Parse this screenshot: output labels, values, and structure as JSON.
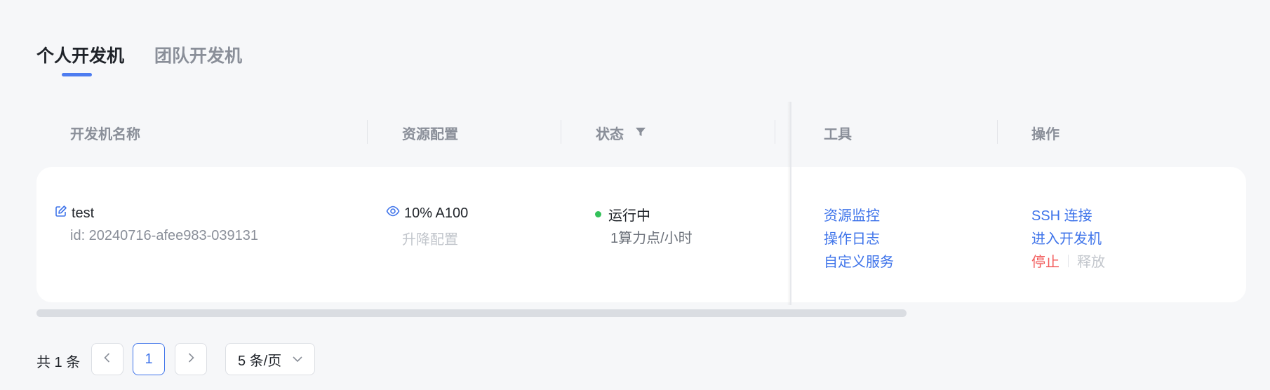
{
  "tabs": [
    {
      "label": "个人开发机",
      "active": true
    },
    {
      "label": "团队开发机",
      "active": false
    }
  ],
  "table": {
    "columns": [
      "开发机名称",
      "资源配置",
      "状态",
      "工具",
      "操作"
    ],
    "rows": [
      {
        "name": "test",
        "id": "id: 20240716-afee983-039131",
        "resource": "10% A100",
        "resource_action": "升降配置",
        "status": "运行中",
        "status_detail": "1算力点/小时",
        "tools": [
          "资源监控",
          "操作日志",
          "自定义服务"
        ],
        "actions": [
          "SSH 连接",
          "进入开发机",
          "停止",
          "释放"
        ]
      }
    ]
  },
  "pagination": {
    "total_label": "共 1 条",
    "current_page": "1",
    "page_size_label": "5 条/页"
  },
  "colors": {
    "accent": "#3f74ea",
    "running": "#34c15a",
    "danger": "#f25a5a",
    "muted": "#8a8f99"
  },
  "icons": {
    "edit": "edit-icon",
    "eye": "eye-icon",
    "filter": "filter-icon",
    "prev": "chevron-left-icon",
    "next": "chevron-right-icon",
    "dropdown": "chevron-down-icon"
  }
}
